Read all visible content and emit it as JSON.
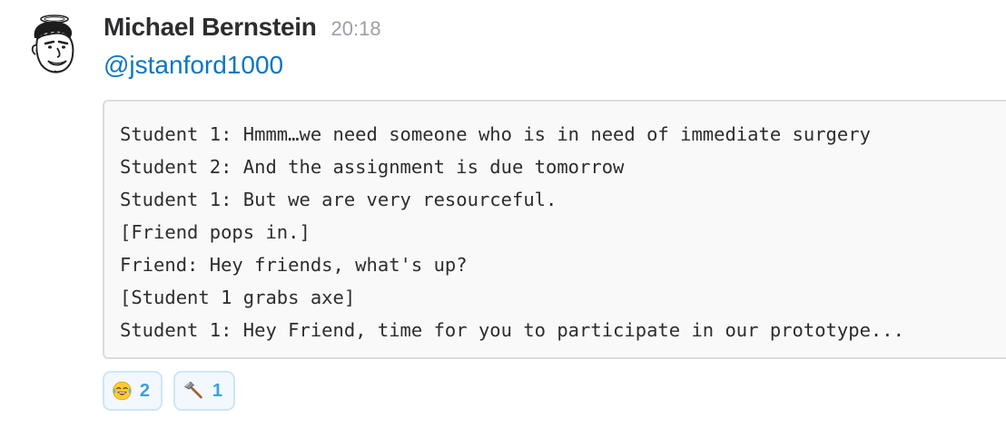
{
  "message": {
    "sender": "Michael Bernstein",
    "timestamp": "20:18",
    "mention": "@jstanford1000",
    "avatar_icon": "cartoon-face-avatar",
    "code_lines": [
      "Student 1: Hmmm…we need someone who is in need of immediate surgery",
      "Student 2: And the assignment is due tomorrow",
      "Student 1: But we are very resourceful.",
      "[Friend pops in.]",
      "Friend: Hey friends, what's up?",
      "[Student 1 grabs axe]",
      "Student 1: Hey Friend, time for you to participate in our prototype..."
    ]
  },
  "reactions": [
    {
      "emoji": "joy-emoji",
      "count": "2"
    },
    {
      "emoji": "axe-emoji",
      "count": "1"
    }
  ],
  "colors": {
    "mention": "#0b76c4",
    "timestamp": "#9e9ea6",
    "reaction_count": "#3a9fe0",
    "reaction_border": "#cfe5f7",
    "code_background": "#f9f9f9"
  }
}
